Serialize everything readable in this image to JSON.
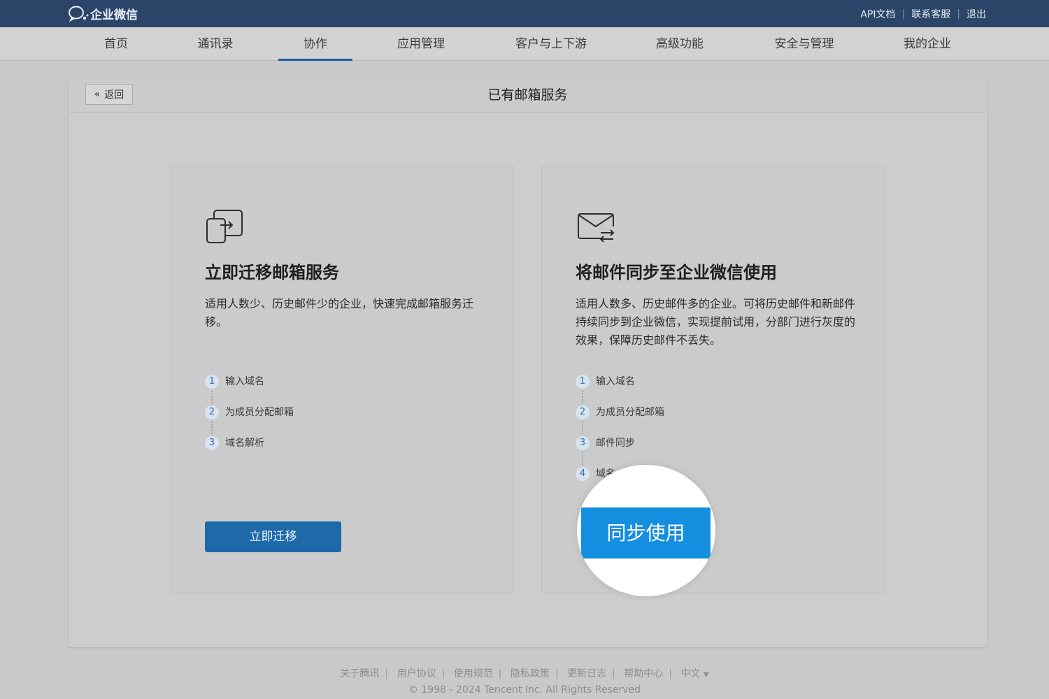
{
  "header": {
    "brand": "企业微信",
    "links": [
      "API文档",
      "联系客服",
      "退出"
    ]
  },
  "nav": {
    "items": [
      "首页",
      "通讯录",
      "协作",
      "应用管理",
      "客户与上下游",
      "高级功能",
      "安全与管理",
      "我的企业"
    ],
    "active": "协作"
  },
  "panel": {
    "back_label": "返回",
    "title": "已有邮箱服务"
  },
  "cards": [
    {
      "icon": "migrate-icon",
      "title": "立即迁移邮箱服务",
      "description": "适用人数少、历史邮件少的企业，快速完成邮箱服务迁移。",
      "steps": [
        {
          "num": "1",
          "label": "输入域名"
        },
        {
          "num": "2",
          "label": "为成员分配邮箱"
        },
        {
          "num": "3",
          "label": "域名解析"
        }
      ],
      "button_label": "立即迁移"
    },
    {
      "icon": "mail-sync-icon",
      "title": "将邮件同步至企业微信使用",
      "description": "适用人数多、历史邮件多的企业。可将历史邮件和新邮件持续同步到企业微信，实现提前试用，分部门进行灰度的效果，保障历史邮件不丢失。",
      "steps": [
        {
          "num": "1",
          "label": "输入域名"
        },
        {
          "num": "2",
          "label": "为成员分配邮箱"
        },
        {
          "num": "3",
          "label": "邮件同步"
        },
        {
          "num": "4",
          "label": "域名"
        }
      ],
      "button_label": "同步使用"
    }
  ],
  "footer": {
    "links": [
      "关于腾讯",
      "用户协议",
      "使用规范",
      "隐私政策",
      "更新日志",
      "帮助中心"
    ],
    "language": "中文",
    "copyright": "© 1998 - 2024 Tencent Inc. All Rights Reserved"
  },
  "colors": {
    "topbar": "#2b4468",
    "primary_button": "#1e6aa8",
    "highlight_button": "#148fe0",
    "nav_active_underline": "#1f5d9e"
  }
}
